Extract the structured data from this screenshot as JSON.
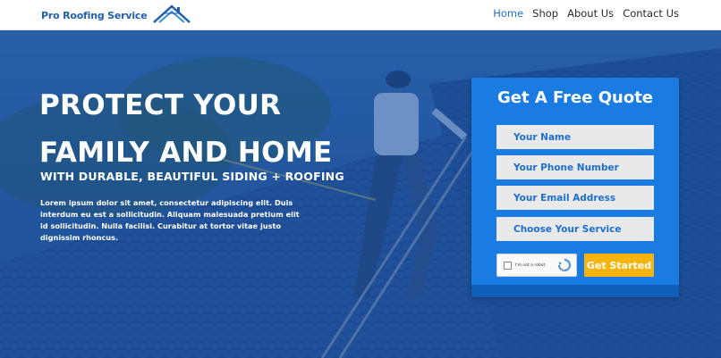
{
  "brand": {
    "name": "Pro Roofing Service",
    "accent": "#1b74d8"
  },
  "nav": {
    "items": [
      "Home",
      "Shop",
      "About Us",
      "Contact Us"
    ],
    "active": "Home"
  },
  "hero": {
    "headline_line1": "PROTECT YOUR",
    "headline_line2": "FAMILY AND HOME",
    "subheadline": "WITH DURABLE, BEAUTIFUL SIDING + ROOFING",
    "body": "Lorem ipsum dolor sit amet, consectetur adipiscing elit. Duis interdum eu est a sollicitudin. Aliquam malesuada pretium elit id sollicitudin. Nulla facilisi. Curabitur at tortor vitae justo dignissim rhoncus."
  },
  "quote_form": {
    "title": "Get A Free Quote",
    "fields": {
      "name": "Your Name",
      "phone": "Your Phone Number",
      "email": "Your Email Address",
      "service": "Choose Your Service"
    },
    "captcha_label": "I'm not a robot",
    "submit_label": "Get Started",
    "card_color": "#1a7be3",
    "button_color": "#f6b40d"
  }
}
